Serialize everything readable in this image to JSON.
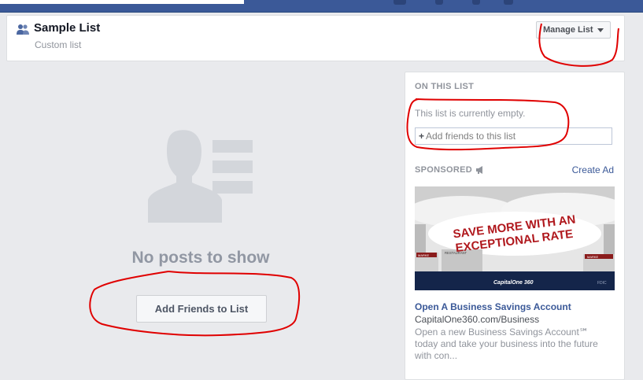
{
  "header": {
    "title": "Sample List",
    "subtitle": "Custom list",
    "manage_label": "Manage List"
  },
  "main": {
    "empty_heading": "No posts to show",
    "add_button": "Add Friends to List"
  },
  "sidebar": {
    "section_label": "ON THIS LIST",
    "empty_text": "This list is currently empty.",
    "add_placeholder": "Add friends to this list",
    "sponsored_label": "SPONSORED",
    "create_ad": "Create Ad",
    "ad": {
      "headline_line1": "SAVE MORE WITH AN",
      "headline_line2": "EXCEPTIONAL RATE",
      "storefront_left": "MARKE",
      "storefront_mid": "RESTAURANT",
      "storefront_right": "MARKE",
      "brand": "CapitalOne 360",
      "fdic": "FDIC",
      "title": "Open A Business Savings Account",
      "domain": "CapitalOne360.com/Business",
      "body": "Open a new Business Savings Account℠ today and take your business into the future with con..."
    }
  },
  "colors": {
    "brand_blue": "#3b5998",
    "annotation_red": "#e00000",
    "ad_banner_red": "#c62026",
    "ad_bar_navy": "#14254a"
  }
}
